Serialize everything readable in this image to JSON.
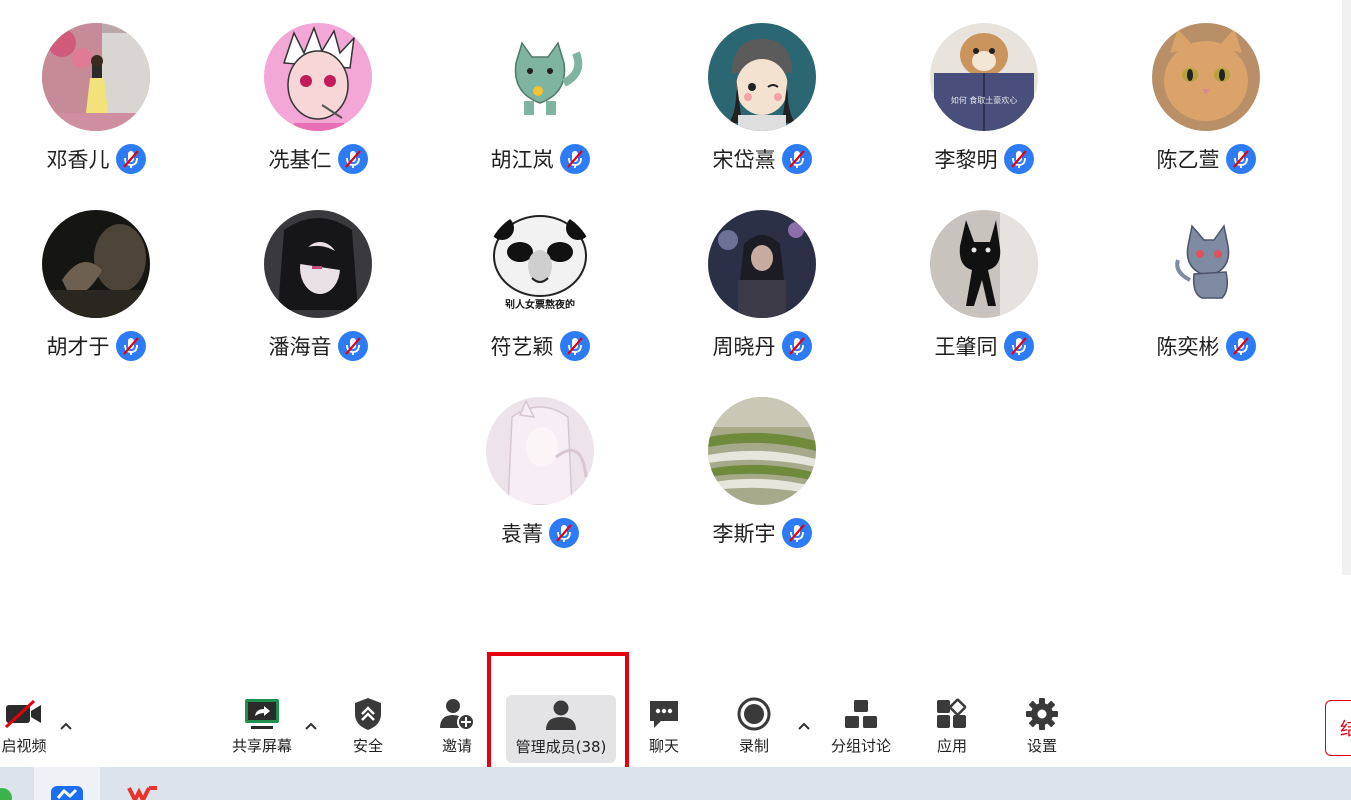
{
  "participants": [
    {
      "name": "邓香儿",
      "avatar": "photo-girl-pink-flowers"
    },
    {
      "name": "冼基仁",
      "avatar": "anime-boy-pink"
    },
    {
      "name": "胡江岚",
      "avatar": "green-cat-cartoon"
    },
    {
      "name": "宋岱熹",
      "avatar": "cartoon-boy-beanie"
    },
    {
      "name": "李黎明",
      "avatar": "dog-reading-book"
    },
    {
      "name": "陈乙萱",
      "avatar": "orange-cat-photo"
    },
    {
      "name": "胡才于",
      "avatar": "dark-photo-hand"
    },
    {
      "name": "潘海音",
      "avatar": "anime-girl-dark"
    },
    {
      "name": "符艺颖",
      "avatar": "panda-meme"
    },
    {
      "name": "周晓丹",
      "avatar": "photo-girl-night"
    },
    {
      "name": "王肇同",
      "avatar": "black-cat-photo"
    },
    {
      "name": "陈奕彬",
      "avatar": "grey-cat-cartoon"
    },
    {
      "name": "袁菁",
      "avatar": "anime-girl-light"
    },
    {
      "name": "李斯宇",
      "avatar": "knit-sweater-photo"
    }
  ],
  "panda_caption": "别人女票熬夜的",
  "book_caption": "如何 食取土豪欢心",
  "toolbar": {
    "video_label": "启视频",
    "share_label": "共享屏幕",
    "security_label": "安全",
    "invite_label": "邀请",
    "members_label": "管理成员(38)",
    "chat_label": "聊天",
    "record_label": "录制",
    "breakout_label": "分组讨论",
    "apps_label": "应用",
    "settings_label": "设置",
    "right_edge_text": "结"
  },
  "colors": {
    "mic_badge": "#2d7cf6",
    "highlight": "#e4000f",
    "active_button_bg": "#e4e4e7",
    "taskbar": "#dde3ea"
  }
}
